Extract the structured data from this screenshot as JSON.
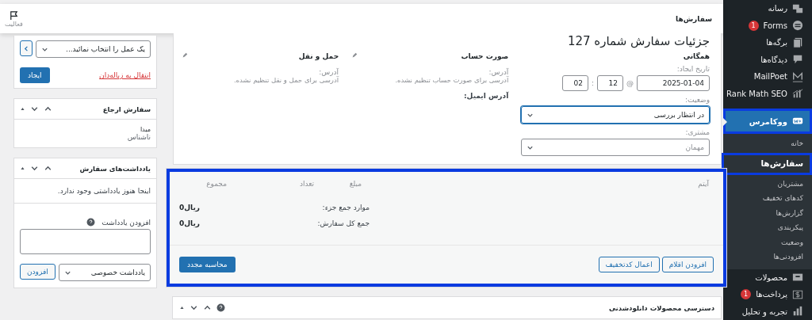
{
  "top_bar": {
    "title": "سفارش‌ها",
    "activity": "فعالیت"
  },
  "sidebar": {
    "items": [
      {
        "label": "رسانه",
        "selected": false,
        "highlighted": false
      },
      {
        "label": "Forms",
        "badge": "1",
        "selected": false,
        "highlighted": false
      },
      {
        "label": "برگه‌ها",
        "selected": false,
        "highlighted": false
      },
      {
        "label": "دیدگاه‌ها",
        "selected": false,
        "highlighted": false
      },
      {
        "label": "MailPoet",
        "selected": false,
        "highlighted": false
      },
      {
        "label": "Rank Math SEO",
        "selected": false,
        "highlighted": false
      },
      {
        "label": "ووکامرس",
        "selected": true,
        "highlighted": true,
        "children": [
          {
            "label": "خانه",
            "selected": false,
            "highlighted": false
          },
          {
            "label": "سفارش‌ها",
            "selected": true,
            "highlighted": true
          },
          {
            "label": "مشتریان",
            "selected": false,
            "highlighted": false
          },
          {
            "label": "کدهای تخفیف",
            "selected": false,
            "highlighted": false
          },
          {
            "label": "گزارش‌ها",
            "selected": false,
            "highlighted": false
          },
          {
            "label": "پیکربندی",
            "selected": false,
            "highlighted": false
          },
          {
            "label": "وضعیت",
            "selected": false,
            "highlighted": false
          },
          {
            "label": "افزودنی‌ها",
            "selected": false,
            "highlighted": false
          }
        ]
      },
      {
        "label": "محصولات",
        "selected": false,
        "highlighted": false
      },
      {
        "label": "پرداخت‌ها",
        "badge": "1",
        "selected": false,
        "highlighted": false
      },
      {
        "label": "تجربه و تحلیل",
        "selected": false,
        "highlighted": false
      }
    ]
  },
  "order_title": "جزئیات سفارش شماره 127",
  "general": {
    "heading": "همگانی",
    "date_label": "تاریخ ایجاد:",
    "date": "2025-01-04",
    "at_sign": "@",
    "hour": "12",
    "separator": ":",
    "minute": "02",
    "status_label": "وضعیت:",
    "status": "در انتظار بررسی",
    "customer_label": "مشتری:",
    "customer_placeholder": "مهمان"
  },
  "billing": {
    "heading": "صورت حساب",
    "address_label": "آدرس:",
    "address_text": "آدرسی برای صورت حساب تنظیم نشده.",
    "email_label": "آدرس ایمیل:"
  },
  "shipping": {
    "heading": "حمل و نقل",
    "address_label": "آدرس:",
    "address_text": "آدرسی برای حمل و نقل تنظیم نشده."
  },
  "items_box": {
    "highlighted": true,
    "columns": [
      "آیتم",
      "مبلغ",
      "تعداد",
      "مجموع"
    ],
    "totals": [
      {
        "label": "موارد جمع جزء:",
        "value": "ریال0"
      },
      {
        "label": "جمع کل سفارش:",
        "value": "ریال0"
      }
    ],
    "buttons": [
      "افزودن اقلام",
      "اعمال کدتخفیف"
    ],
    "recalculate": "محاسبه مجدد"
  },
  "downloads": {
    "title": "دسترسی محصولات دانلودشدنی"
  },
  "actions": {
    "select": "یک عمل را انتخاب نمائید...",
    "trash_link": "انتقال به زباله‌دان",
    "create_button": "ایجاد"
  },
  "attribution": {
    "title": "سفارش ارجاع",
    "source_label": "مبدا",
    "source_value": "ناشناس"
  },
  "notes": {
    "title": "یادداشت‌های سفارش",
    "empty": "اینجا هنوز یادداشتی وجود ندارد.",
    "add_label": "افزودن یادداشت",
    "note_type": "یادداشت خصوصی",
    "add_button": "افزودن"
  }
}
